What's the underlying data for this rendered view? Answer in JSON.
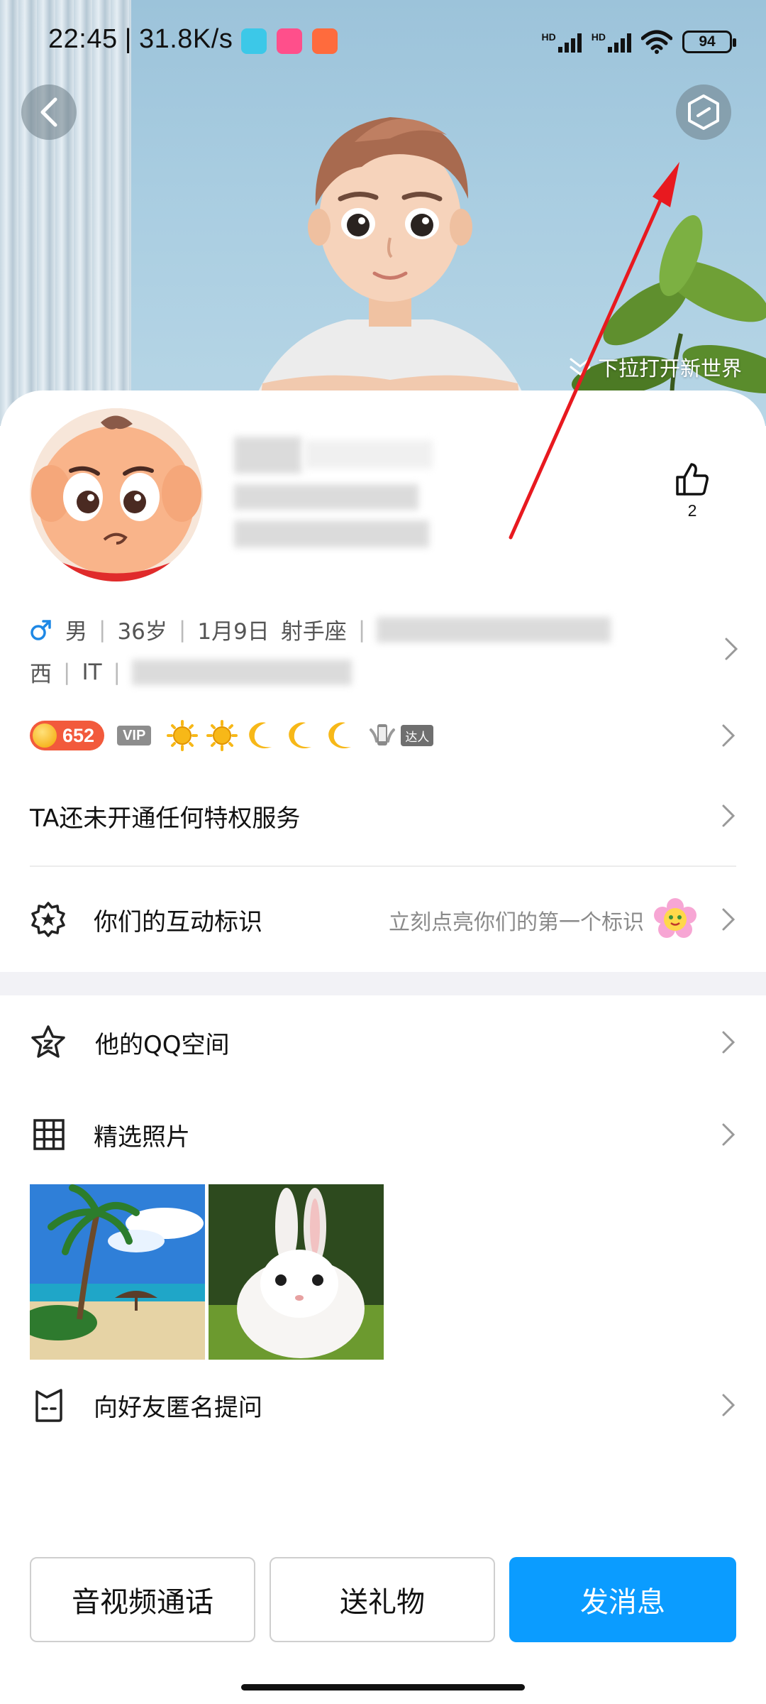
{
  "status_bar": {
    "time": "22:45",
    "net_speed": "31.8K/s",
    "hd1": "HD",
    "hd2": "HD",
    "battery": "94"
  },
  "hero": {
    "pull_hint": "下拉打开新世界"
  },
  "profile": {
    "like_count": "2",
    "gender": "男",
    "age": "36岁",
    "birthday": "1月9日",
    "zodiac": "射手座",
    "location_suffix": "西",
    "industry": "IT",
    "coin_level": "652",
    "vip_label": "VIP",
    "daren_label": "达人"
  },
  "rows": {
    "privilege": "TA还未开通任何特权服务",
    "interaction_title": "你们的互动标识",
    "interaction_hint": "立刻点亮你们的第一个标识",
    "qzone": "他的QQ空间",
    "photos": "精选照片",
    "anon_question": "向好友匿名提问"
  },
  "buttons": {
    "call": "音视频通话",
    "gift": "送礼物",
    "message": "发消息"
  },
  "colors": {
    "primary": "#0b9cff",
    "male_icon": "#1e88e5",
    "annotation_arrow": "#e8191f"
  }
}
